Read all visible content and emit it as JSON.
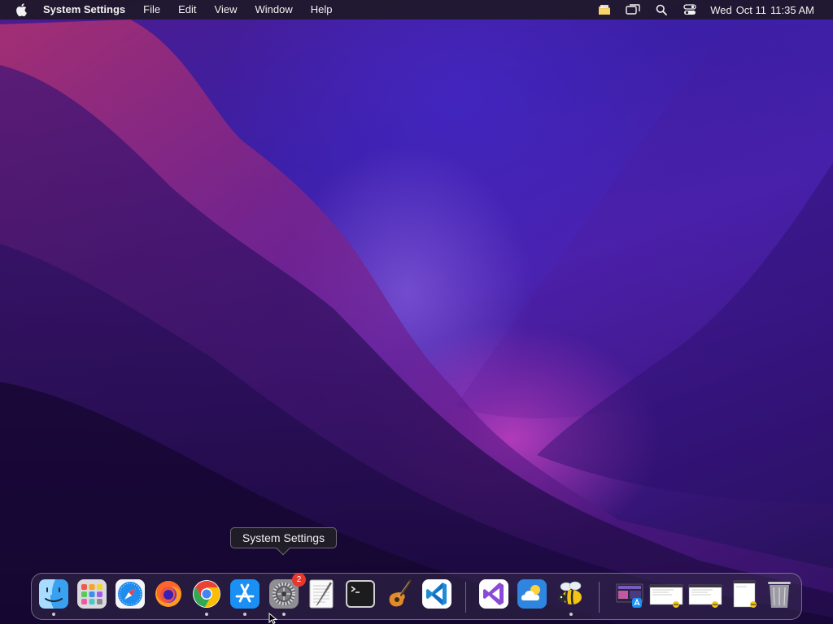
{
  "menubar": {
    "apple_icon": "apple-logo-icon",
    "app_name": "System Settings",
    "menus": [
      "File",
      "Edit",
      "View",
      "Window",
      "Help"
    ],
    "status_icons": [
      "folder-icon",
      "screen-mirroring-icon",
      "spotlight-search-icon",
      "control-center-icon"
    ],
    "clock": {
      "day": "Wed",
      "date": "Oct 11",
      "time": "11:35 AM"
    }
  },
  "tooltip": {
    "text": "System Settings"
  },
  "dock": {
    "apps": [
      {
        "name": "Finder",
        "icon": "finder-icon",
        "running": true
      },
      {
        "name": "Launchpad",
        "icon": "launchpad-icon",
        "running": false
      },
      {
        "name": "Safari",
        "icon": "safari-icon",
        "running": false
      },
      {
        "name": "Firefox",
        "icon": "firefox-icon",
        "running": false
      },
      {
        "name": "Google Chrome",
        "icon": "chrome-icon",
        "running": true
      },
      {
        "name": "App Store",
        "icon": "app-store-icon",
        "running": true
      },
      {
        "name": "System Settings",
        "icon": "system-settings-icon",
        "running": true,
        "badge": "2"
      },
      {
        "name": "TextEdit",
        "icon": "textedit-icon",
        "running": false
      },
      {
        "name": "Terminal",
        "icon": "terminal-icon",
        "running": false
      },
      {
        "name": "GarageBand",
        "icon": "garageband-icon",
        "running": false
      },
      {
        "name": "Visual Studio Code",
        "icon": "vscode-icon",
        "running": false
      }
    ],
    "recent_apps": [
      {
        "name": "Visual Studio",
        "icon": "visual-studio-icon",
        "running": false
      },
      {
        "name": "Weather",
        "icon": "weather-icon",
        "running": false
      },
      {
        "name": "Bee App",
        "icon": "bee-icon",
        "running": true
      }
    ],
    "stacks": [
      {
        "name": "Screenshot Stack 1",
        "icon": "screenshot-stack-icon"
      },
      {
        "name": "Screenshot 2",
        "icon": "screenshot-thumbnail-icon"
      },
      {
        "name": "Screenshot 3",
        "icon": "screenshot-thumbnail-icon"
      },
      {
        "name": "Document",
        "icon": "document-thumbnail-icon"
      },
      {
        "name": "Trash",
        "icon": "trash-icon"
      }
    ]
  },
  "colors": {
    "menubar_bg": "#1e1828",
    "badge": "#e8382d",
    "wallpaper_primary": "#4a22b0",
    "wallpaper_accent": "#d646c8"
  }
}
